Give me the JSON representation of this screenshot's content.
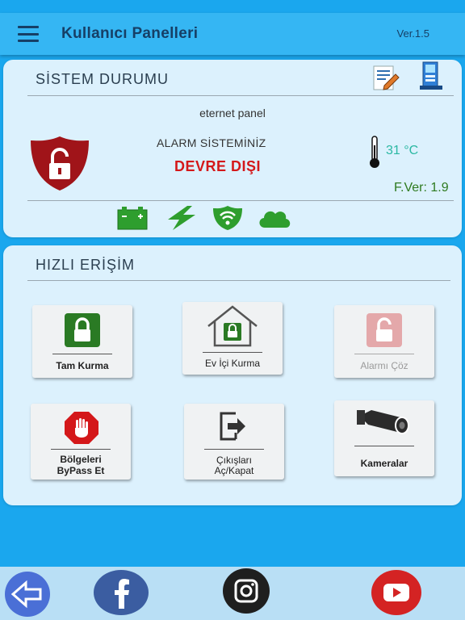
{
  "header": {
    "title": "Kullanıcı Panelleri",
    "version": "Ver.1.5",
    "menu_icon": "hamburger-menu-icon"
  },
  "system": {
    "title": "SİSTEM DURUMU",
    "connection": "eternet panel",
    "alarm_label": "ALARM SİSTEMİNİZ",
    "alarm_status": "DEVRE DIŞI",
    "temperature": "31 °C",
    "firmware": "F.Ver: 1.9",
    "status_color": "#d4181a",
    "ok_color": "#2e9e2e",
    "icons": [
      "battery-icon",
      "power-icon",
      "wifi-shield-icon",
      "cloud-icon"
    ]
  },
  "quick": {
    "title": "HIZLI ERİŞİM",
    "buttons": {
      "arm_full": "Tam Kurma",
      "arm_home": "Ev İçi Kurma",
      "disarm": "Alarmı Çöz",
      "bypass_line1": "Bölgeleri",
      "bypass_line2": "ByPass Et",
      "outputs_line1": "Çıkışları",
      "outputs_line2": "Aç/Kapat",
      "cameras": "Kameralar"
    }
  },
  "bottom": {
    "icons": [
      "back-icon",
      "facebook-icon",
      "instagram-icon",
      "youtube-icon"
    ]
  }
}
